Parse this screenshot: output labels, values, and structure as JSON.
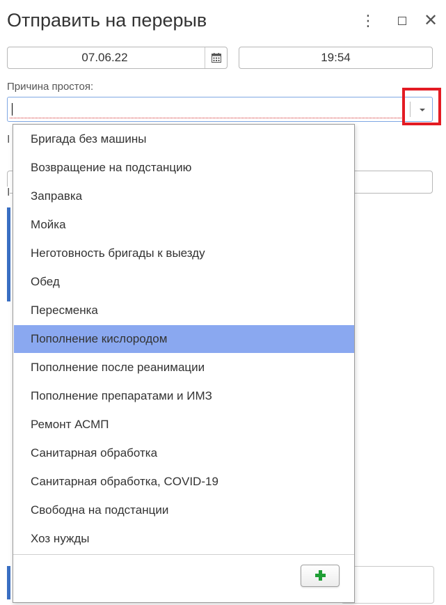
{
  "window": {
    "title": "Отправить на перерыв",
    "more_icon": "⋮",
    "close_icon": "✕"
  },
  "form": {
    "date_value": "07.06.22",
    "time_value": "19:54",
    "reason_label": "Причина простоя:",
    "reason_value": "",
    "hidden_label_fragment": "I",
    "hidden_label_fragment2": "I"
  },
  "dropdown": {
    "options": [
      "Бригада без машины",
      "Возвращение на подстанцию",
      "Заправка",
      "Мойка",
      "Неготовность бригады к выезду",
      "Обед",
      "Пересменка",
      "Пополнение кислородом",
      "Пополнение после реанимации",
      "Пополнение препаратами и ИМЗ",
      "Ремонт АСМП",
      "Санитарная обработка",
      "Санитарная обработка, COVID-19",
      "Свободна на подстанции",
      "Хоз нужды"
    ],
    "selected_option": "Пополнение кислородом",
    "add_icon": "plus-icon"
  },
  "colors": {
    "highlight_border": "#e31b23",
    "selected_row": "#8aa8f0",
    "add_plus": "#1f9e35",
    "focus_border": "#7fa7e3"
  }
}
